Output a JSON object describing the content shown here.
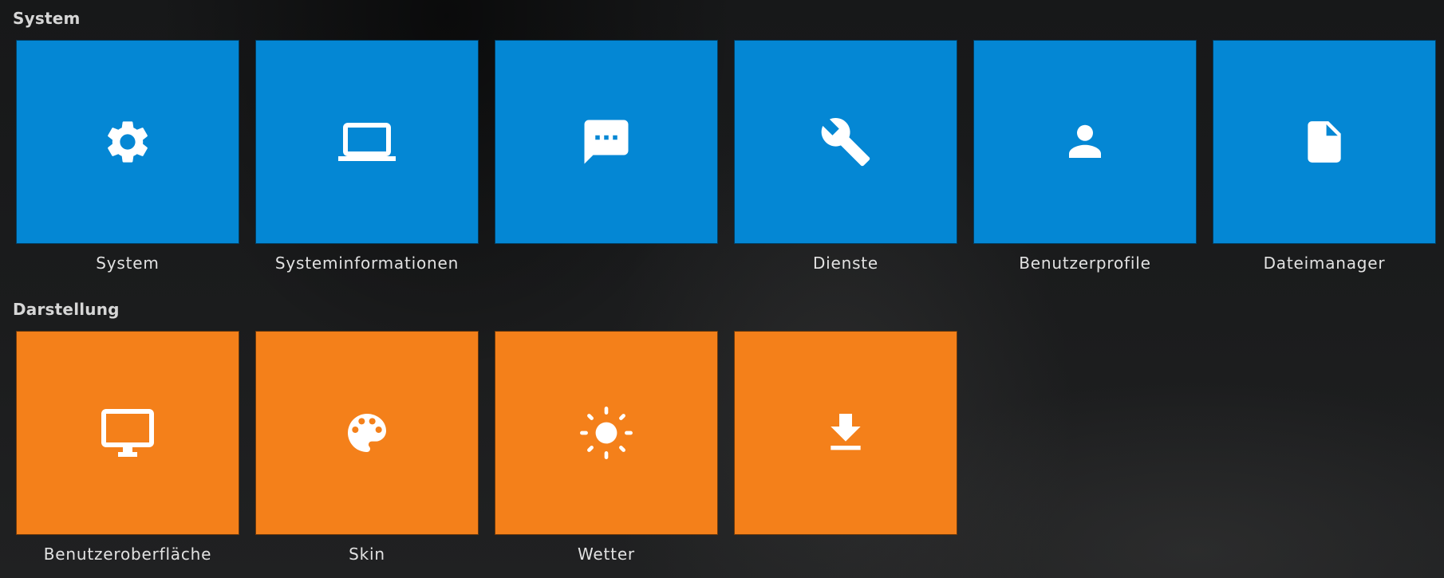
{
  "sections": {
    "system": {
      "title": "System",
      "color": "#0487d4",
      "tiles": [
        {
          "label": "System",
          "icon": "gear-icon"
        },
        {
          "label": "Systeminformationen",
          "icon": "laptop-icon"
        },
        {
          "label": "",
          "icon": "chat-bubble-icon"
        },
        {
          "label": "Dienste",
          "icon": "wrench-icon"
        },
        {
          "label": "Benutzerprofile",
          "icon": "user-icon"
        },
        {
          "label": "Dateimanager",
          "icon": "file-icon"
        }
      ]
    },
    "darstellung": {
      "title": "Darstellung",
      "color": "#f4801a",
      "tiles": [
        {
          "label": "Benutzeroberfläche",
          "icon": "monitor-icon"
        },
        {
          "label": "Skin",
          "icon": "palette-icon"
        },
        {
          "label": "Wetter",
          "icon": "sun-icon"
        },
        {
          "label": "",
          "icon": "download-icon"
        }
      ]
    }
  }
}
